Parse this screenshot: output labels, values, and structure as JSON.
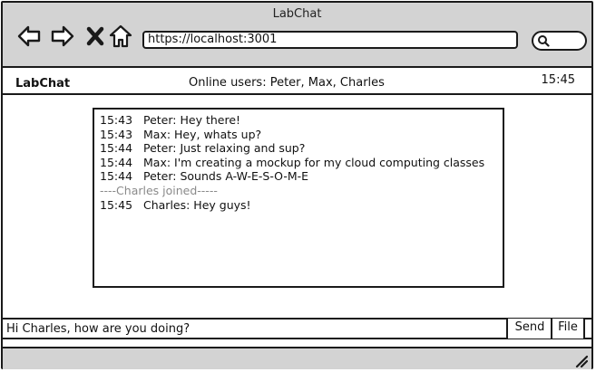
{
  "window": {
    "title": "LabChat"
  },
  "browser": {
    "url": "https://localhost:3001",
    "icons": {
      "back": "back-arrow-icon",
      "forward": "forward-arrow-icon",
      "stop": "stop-x-icon",
      "home": "home-icon",
      "search": "search-icon",
      "resize": "resize-grip-icon"
    }
  },
  "app": {
    "title": "LabChat",
    "online_users": "Online users: Peter, Max, Charles",
    "time": "15:45"
  },
  "messages": [
    {
      "time": "15:43",
      "text": "Peter: Hey there!"
    },
    {
      "time": "15:43",
      "text": "Max: Hey, whats up?"
    },
    {
      "time": "15:44",
      "text": "Peter: Just relaxing and sup?"
    },
    {
      "time": "15:44",
      "text": "Max: I'm creating a mockup for my cloud computing classes"
    },
    {
      "time": "15:44",
      "text": "Peter: Sounds A-W-E-S-O-M-E"
    }
  ],
  "system_notice": "----Charles joined-----",
  "messages_after": [
    {
      "time": "15:45",
      "text": "Charles: Hey guys!"
    }
  ],
  "composer": {
    "value": "Hi Charles, how are you doing?",
    "send_label": "Send",
    "file_label": "File"
  }
}
